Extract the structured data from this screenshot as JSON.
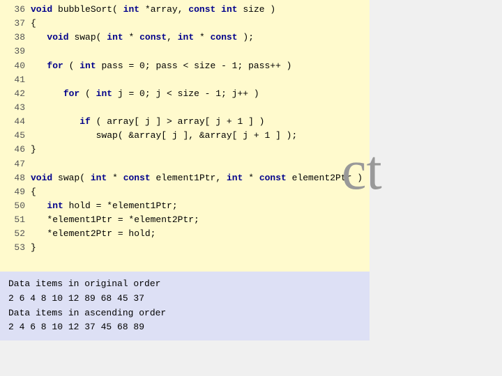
{
  "code": {
    "lines": [
      {
        "num": "36",
        "html": "<span class='kw'>void</span> <span class='plain'>bubbleSort(</span> <span class='type'>int</span> <span class='plain'>*array,</span> <span class='kw'>const</span> <span class='type'>int</span> <span class='plain'>size )</span>"
      },
      {
        "num": "37",
        "html": "<span class='plain'>{</span>"
      },
      {
        "num": "38",
        "html": "   <span class='kw'>void</span> <span class='plain'>swap(</span> <span class='type'>int</span> <span class='plain'>*</span> <span class='kw'>const</span><span class='plain'>,</span> <span class='type'>int</span> <span class='plain'>*</span> <span class='kw'>const</span> <span class='plain'>);</span>"
      },
      {
        "num": "39",
        "html": ""
      },
      {
        "num": "40",
        "html": "   <span class='kw'>for</span> <span class='plain'>( </span><span class='type'>int</span><span class='plain'> pass = 0; pass &lt; size - 1; pass++ )</span>"
      },
      {
        "num": "41",
        "html": ""
      },
      {
        "num": "42",
        "html": "      <span class='kw'>for</span> <span class='plain'>( </span><span class='type'>int</span><span class='plain'> j = 0; j &lt; size - 1; j++ )</span>"
      },
      {
        "num": "43",
        "html": ""
      },
      {
        "num": "44",
        "html": "         <span class='kw'>if</span> <span class='plain'>( array[ j ] &gt; array[ j + 1 ] )</span>"
      },
      {
        "num": "45",
        "html": "            <span class='plain'>swap( &amp;array[ j ], &amp;array[ j + 1 ] );</span>"
      },
      {
        "num": "46",
        "html": "<span class='plain'>}</span>"
      },
      {
        "num": "47",
        "html": ""
      },
      {
        "num": "48",
        "html": "<span class='kw'>void</span> <span class='plain'>swap(</span> <span class='type'>int</span> <span class='plain'>*</span> <span class='kw'>const</span> <span class='plain'>element1Ptr,</span> <span class='type'>int</span> <span class='plain'>*</span> <span class='kw'>const</span> <span class='plain'>element2Ptr )</span>"
      },
      {
        "num": "49",
        "html": "<span class='plain'>{</span>"
      },
      {
        "num": "50",
        "html": "   <span class='type'>int</span> <span class='plain'>hold = *element1Ptr;</span>"
      },
      {
        "num": "51",
        "html": "   <span class='plain'>*element1Ptr = *element2Ptr;</span>"
      },
      {
        "num": "52",
        "html": "   <span class='plain'>*element2Ptr = hold;</span>"
      },
      {
        "num": "53",
        "html": "<span class='plain'>}</span>"
      }
    ]
  },
  "output": {
    "lines": [
      "Data items in original order",
      "    2    6    4    8   10   12   89   68   45   37",
      "Data items in ascending order",
      "    2    4    6    8   10   12   37   45   68   89"
    ]
  },
  "deco": "ct"
}
